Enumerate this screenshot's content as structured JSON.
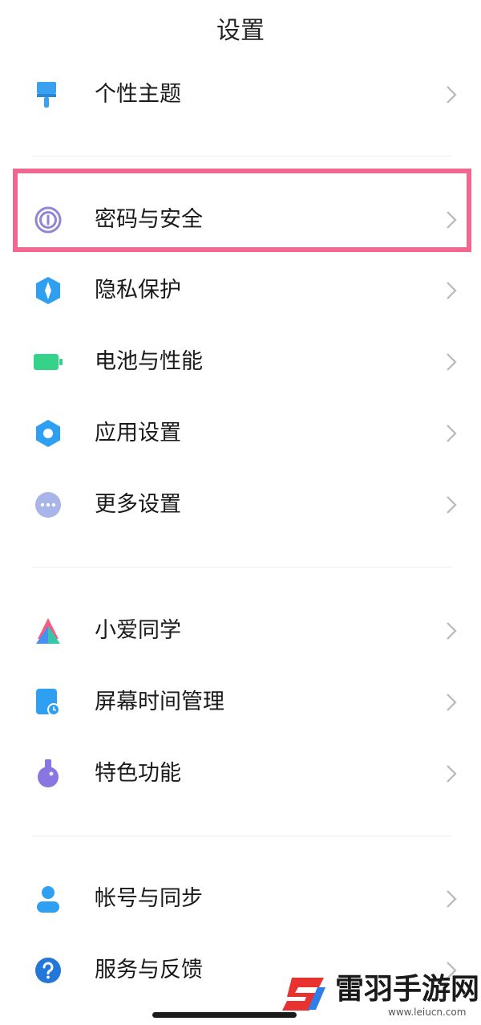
{
  "header": {
    "title": "设置"
  },
  "items": [
    {
      "label": "个性主题",
      "icon": "paintbrush-icon",
      "color": "#3aa0f0"
    },
    {
      "label": "密码与安全",
      "icon": "fingerprint-icon",
      "color": "#8f86d6",
      "highlighted": true
    },
    {
      "label": "隐私保护",
      "icon": "shield-icon",
      "color": "#2f9ff2"
    },
    {
      "label": "电池与性能",
      "icon": "battery-icon",
      "color": "#35d28a"
    },
    {
      "label": "应用设置",
      "icon": "gear-icon",
      "color": "#2f9ff2"
    },
    {
      "label": "更多设置",
      "icon": "more-dots-icon",
      "color": "#a9b5e8"
    },
    {
      "label": "小爱同学",
      "icon": "xiaoai-icon",
      "color": "#f25f83"
    },
    {
      "label": "屏幕时间管理",
      "icon": "screen-time-icon",
      "color": "#2f9ff2"
    },
    {
      "label": "特色功能",
      "icon": "flask-icon",
      "color": "#8a76e0"
    },
    {
      "label": "帐号与同步",
      "icon": "account-icon",
      "color": "#2f9ff2"
    },
    {
      "label": "服务与反馈",
      "icon": "help-icon",
      "color": "#2277d8"
    }
  ],
  "highlight_color": "#f0678f",
  "watermark": {
    "text": "雷羽手游网",
    "url": "www.leiucn.com"
  }
}
